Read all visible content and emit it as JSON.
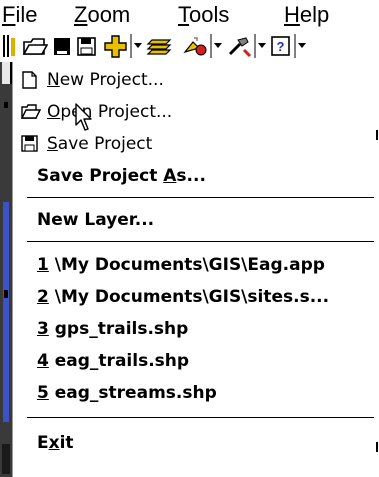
{
  "menubar": {
    "items": [
      {
        "accel": "F",
        "rest": "ile"
      },
      {
        "accel": "Z",
        "rest": "oom"
      },
      {
        "accel": "T",
        "rest": "ools"
      },
      {
        "accel": "H",
        "rest": "elp"
      }
    ]
  },
  "toolbar": {
    "icons": [
      "grip-icon",
      "folder-open-icon",
      "dark-doc-icon",
      "save-icon",
      "add-layer-icon",
      "layers-icon",
      "identify-icon",
      "tools-icon",
      "help-icon"
    ]
  },
  "file_menu": {
    "new_project": {
      "accel": "N",
      "rest": "ew Project..."
    },
    "open_project": {
      "accel": "O",
      "rest": "pen Project..."
    },
    "save_project": {
      "accel": "S",
      "rest": "ave Project"
    },
    "save_project_as": {
      "before": "Save Project ",
      "accel": "A",
      "rest": "s..."
    },
    "new_layer": "New Layer...",
    "recent": [
      {
        "num": "1",
        "path": " \\My Documents\\GIS\\Eag.app"
      },
      {
        "num": "2",
        "path": " \\My Documents\\GIS\\sites.s..."
      },
      {
        "num": "3",
        "path": " gps_trails.shp"
      },
      {
        "num": "4",
        "path": " eag_trails.shp"
      },
      {
        "num": "5",
        "path": " eag_streams.shp"
      }
    ],
    "exit": {
      "before": "E",
      "accel": "x",
      "rest": "it"
    }
  }
}
